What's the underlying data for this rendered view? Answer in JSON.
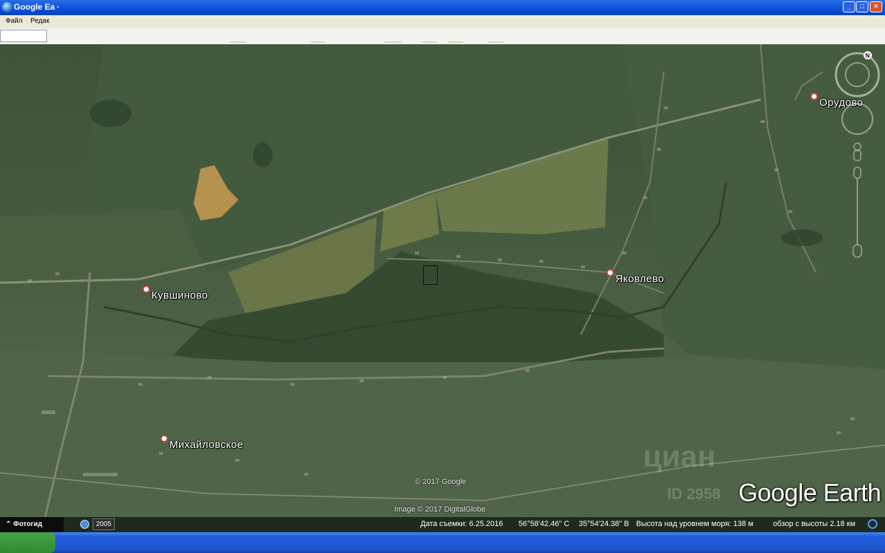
{
  "window": {
    "title": "Google Ea",
    "title_ext": "·"
  },
  "menu": {
    "items": [
      "Файл",
      "Редак"
    ]
  },
  "map": {
    "places": [
      {
        "id": "orudovo",
        "name": "Орудово"
      },
      {
        "id": "yakovlevo",
        "name": "Яковлево"
      },
      {
        "id": "kuvshinovo",
        "name": "Кувшиново"
      },
      {
        "id": "mikhaylovskoe",
        "name": "Михайловское"
      }
    ],
    "copyright_google": "© 2017 Google",
    "copyright_imagery": "Image © 2017 DigitalGlobe",
    "watermark": "циан",
    "watermark_id": "ID 2958",
    "logo": "Google Earth"
  },
  "status": {
    "tour_guide": "⌃ Фотогид",
    "year": "2005",
    "imagery_date": "Дата съемки: 6.25.2016",
    "lat": "56°58'42.46\" С",
    "lon": "35°54'24.38\" В",
    "elevation": "Высота над уровнем моря:   138 м",
    "eye_alt": "обзор с высоты   2.18 км"
  },
  "colors": {
    "titlebar": "#0a4fd6",
    "pin": "#c64040",
    "menubar": "#ece9d8"
  }
}
